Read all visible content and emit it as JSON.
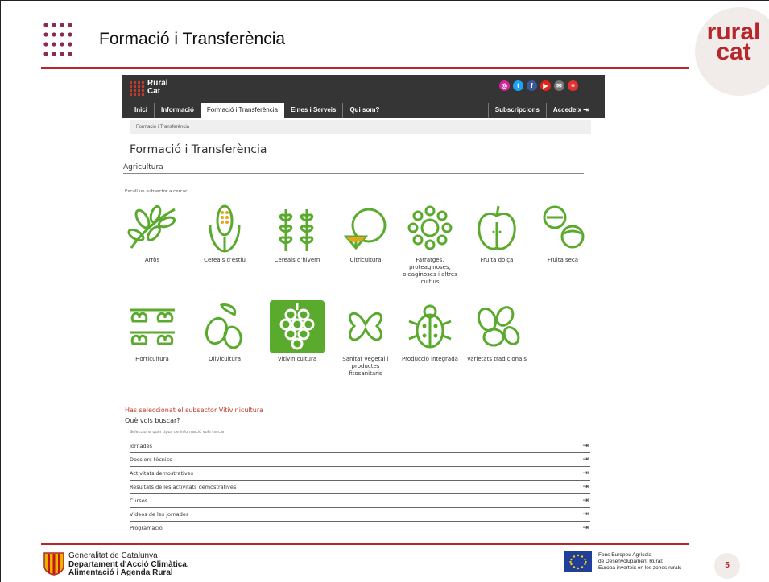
{
  "slide": {
    "title": "Formació i Transferència",
    "brand": [
      "rural",
      "cat"
    ],
    "page_number": "5",
    "accent_color": "#b7262c"
  },
  "site": {
    "logo_text": [
      "Rural",
      "Cat"
    ],
    "nav": [
      "Inici",
      "Informació",
      "Formació i Transferència",
      "Eines i Serveis",
      "Qui som?"
    ],
    "nav_active": "Formació i Transferència",
    "nav_right": [
      "Subscripcions",
      "Accedeix"
    ],
    "socials": [
      "instagram-icon",
      "twitter-icon",
      "facebook-icon",
      "youtube-icon",
      "email-icon",
      "rss-icon"
    ],
    "breadcrumb": "Formació i Transferència",
    "heading": "Formació i Transferència",
    "sector": "Agricultura",
    "choose_hint": "Escull un subsector a cercar",
    "subsectors": [
      {
        "label": "Arròs",
        "icon": "rice-icon"
      },
      {
        "label": "Cereals d'estiu",
        "icon": "corn-icon"
      },
      {
        "label": "Cereals d'hivern",
        "icon": "wheat-icon"
      },
      {
        "label": "Citricultura",
        "icon": "citrus-icon"
      },
      {
        "label": "Farratges, proteaginoses, oleaginoses i altres cultius",
        "icon": "sunflower-icon"
      },
      {
        "label": "Fruita dolça",
        "icon": "apple-icon"
      },
      {
        "label": "Fruita seca",
        "icon": "hazelnut-icon"
      },
      {
        "label": "Horticultura",
        "icon": "vegetables-icon"
      },
      {
        "label": "Olivicultura",
        "icon": "olive-icon"
      },
      {
        "label": "Vitivinicultura",
        "icon": "grapes-icon"
      },
      {
        "label": "Sanitat vegetal i productes fitosanitaris",
        "icon": "plant-health-icon"
      },
      {
        "label": "Producció integrada",
        "icon": "ladybug-icon"
      },
      {
        "label": "Varietats tradicionals",
        "icon": "beans-icon"
      }
    ],
    "selected_message": "Has seleccionat el subsector Vitivinicultura",
    "question": "Què vols buscar?",
    "question_hint": "Selecciona quin tipus de informació vols cercar",
    "options": [
      "Jornades",
      "Dossiers tècnics",
      "Activitats demostratives",
      "Resultats de les activitats demostratives",
      "Cursos",
      "Vídeos de les jornades",
      "Programació"
    ]
  },
  "footer": {
    "gov_lines": [
      "Generalitat de Catalunya",
      "Departament d'Acció Climàtica,",
      "Alimentació i Agenda Rural"
    ],
    "eu_lines": [
      "Fons Europeu Agrícola",
      "de Desenvolupament Rural:",
      "Europa inverteix en les zones rurals"
    ]
  }
}
